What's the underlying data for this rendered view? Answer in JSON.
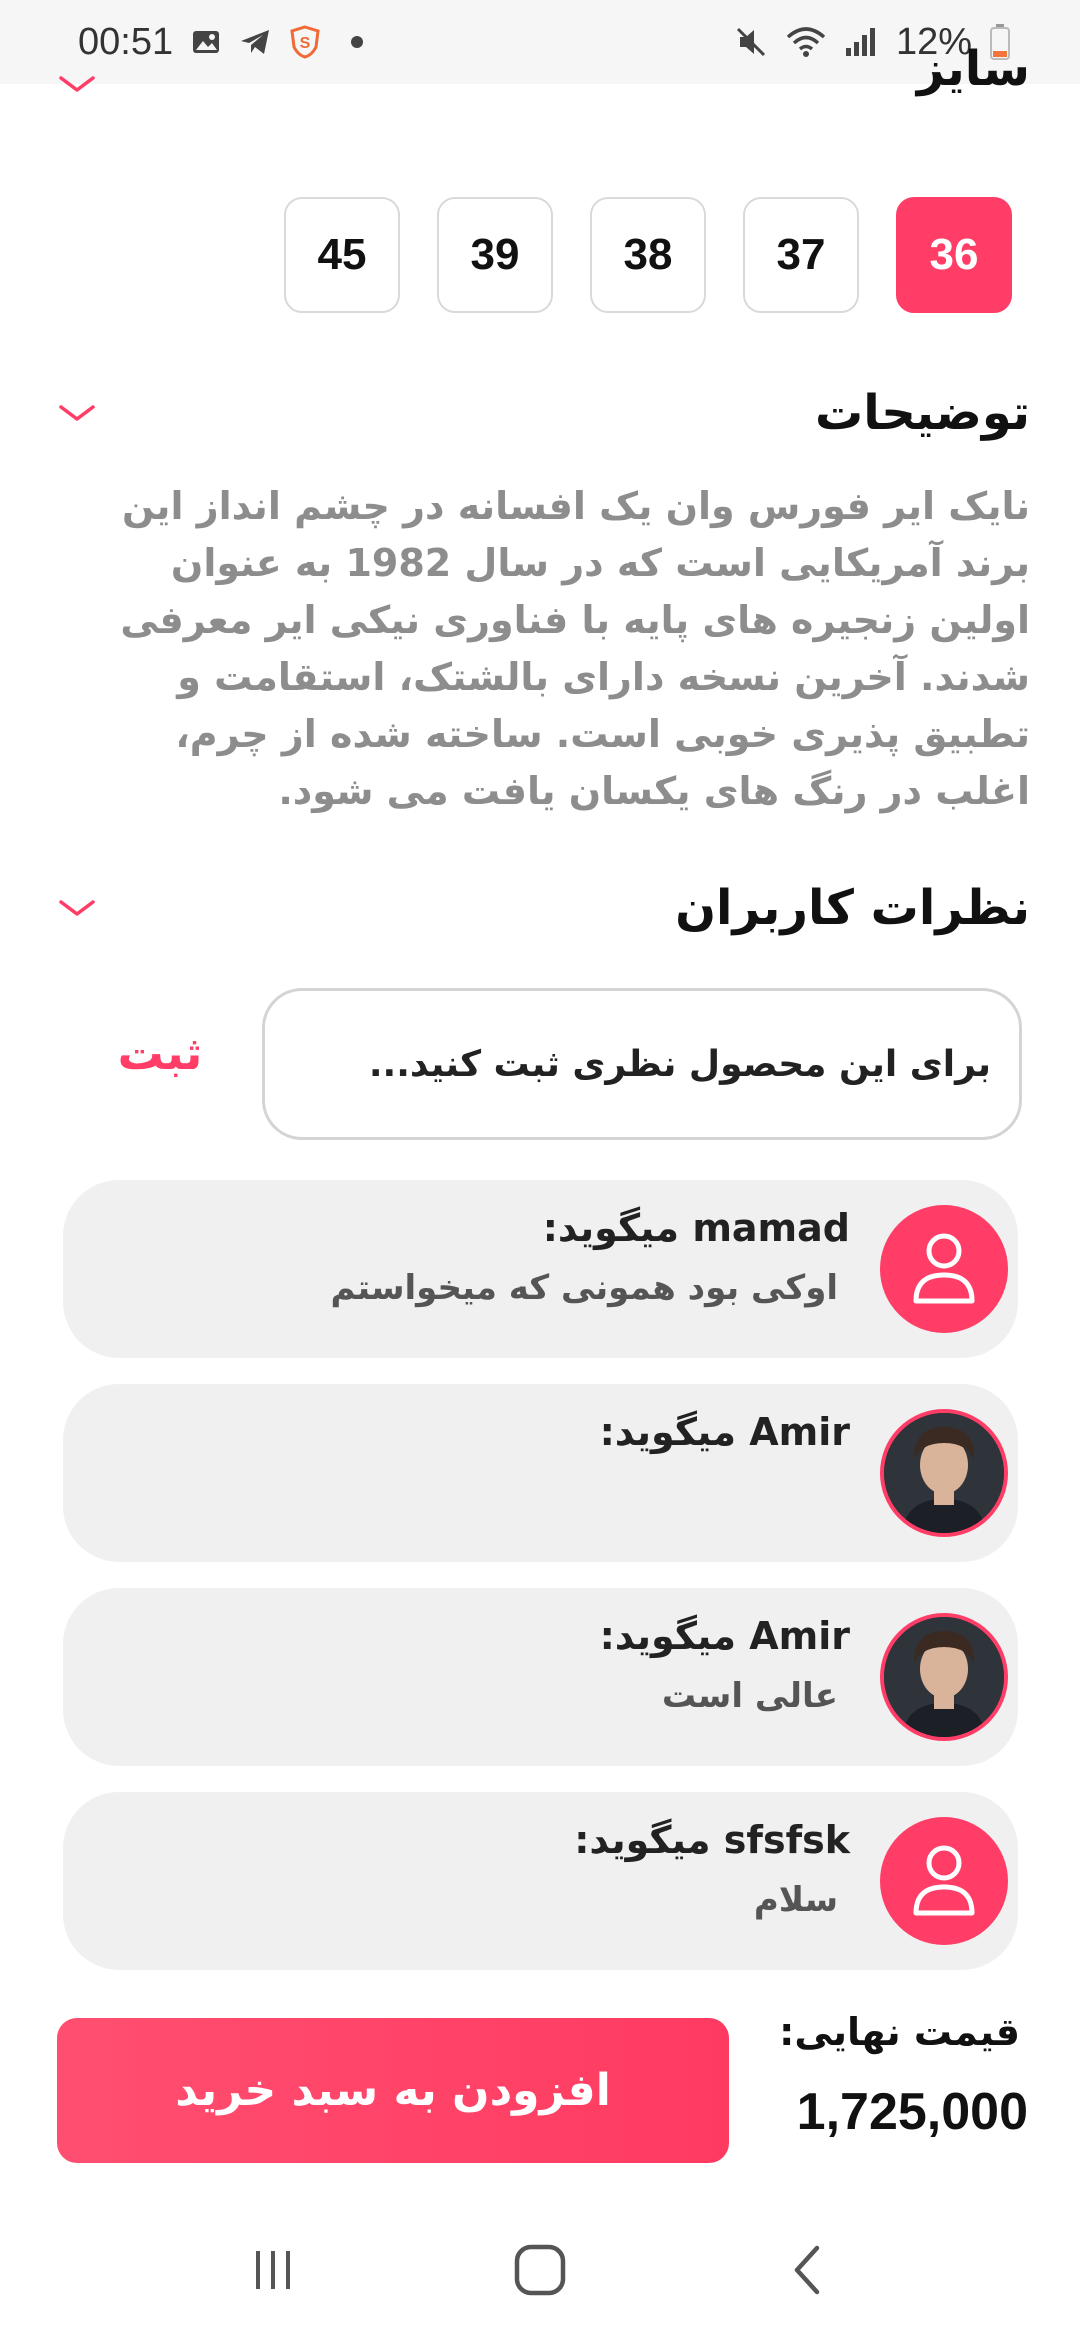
{
  "status_bar": {
    "time": "00:51",
    "battery_text": "12%",
    "icons_left": [
      "gallery-icon",
      "telegram-icon",
      "shield-app-icon",
      "dot"
    ],
    "icons_right": [
      "mute-icon",
      "wifi-icon",
      "signal-icon",
      "battery-icon"
    ]
  },
  "sections": {
    "size_title": "سایز",
    "description_title": "توضیحات",
    "comments_title": "نظرات کاربران"
  },
  "sizes": {
    "options": [
      "36",
      "37",
      "38",
      "39",
      "45"
    ],
    "selected": "36"
  },
  "description": {
    "text": "نایک ایر فورس وان یک افسانه در چشم انداز این برند آمریکایی است که در سال 1982 به عنوان اولین زنجیره های پایه با فناوری نیکی ایر معرفی شدند. آخرین نسخه دارای بالشتک، استقامت و تطبیق پذیری خوبی است. ساخته شده از چرم، اغلب در رنگ های یکسان یافت می شود."
  },
  "comment_form": {
    "placeholder": "برای این محصول نظری ثبت کنید...",
    "submit_label": "ثبت"
  },
  "comments": [
    {
      "author": "mamad میگوید:",
      "text": "اوکی بود همونی که میخواستم",
      "avatar": "default"
    },
    {
      "author": "Amir میگوید:",
      "text": "",
      "avatar": "photo"
    },
    {
      "author": "Amir میگوید:",
      "text": "عالی است",
      "avatar": "photo"
    },
    {
      "author": "sfsfsk میگوید:",
      "text": "سلام",
      "avatar": "default"
    }
  ],
  "footer": {
    "cart_button": "افزودن به سبد خرید",
    "price_label": "قیمت نهایی:",
    "price_value": "1,725,000"
  },
  "colors": {
    "accent": "#ff3d67",
    "card_bg": "#f0f0f0",
    "muted_text": "#8d8d8d"
  }
}
